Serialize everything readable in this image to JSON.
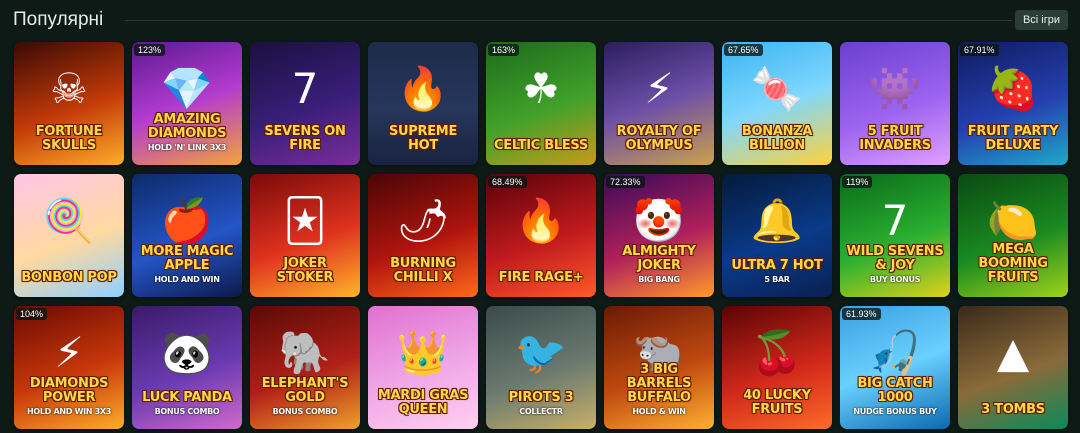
{
  "header": {
    "title": "Популярні",
    "all_button": "Всі ігри"
  },
  "games": [
    {
      "name": "Fortune Skulls",
      "sub": "",
      "badge": "",
      "icon": "skull-icon",
      "glyph": "☠",
      "bg": "linear-gradient(160deg,#3a0a05,#c33a08 55%,#ffae2a)"
    },
    {
      "name": "Amazing Diamonds",
      "sub": "HOLD 'N' LINK 3X3",
      "badge": "123%",
      "icon": "diamond-icon",
      "glyph": "💎",
      "bg": "linear-gradient(160deg,#5b1a8f,#b33bd0 50%,#f3a33a)"
    },
    {
      "name": "Sevens on Fire",
      "sub": "",
      "badge": "",
      "icon": "seven-icon",
      "glyph": "7",
      "bg": "linear-gradient(160deg,#1a1040,#3a1e7a 55%,#7a2e9a)"
    },
    {
      "name": "Supreme Hot",
      "sub": "",
      "badge": "",
      "icon": "flame-icon",
      "glyph": "🔥",
      "bg": "linear-gradient(180deg,#1e2a4a,#26365c 55%,#1a2340)"
    },
    {
      "name": "Celtic Bless",
      "sub": "",
      "badge": "163%",
      "icon": "leprechaun-icon",
      "glyph": "☘",
      "bg": "linear-gradient(160deg,#1d6a1a,#41a12b 55%,#c89a1a)"
    },
    {
      "name": "Royalty of Olympus",
      "sub": "",
      "badge": "",
      "icon": "zeus-icon",
      "glyph": "⚡",
      "bg": "linear-gradient(160deg,#2a1e5e,#6d4fa8 50%,#caa14a)"
    },
    {
      "name": "Bonanza Billion",
      "sub": "",
      "badge": "67.65%",
      "icon": "candy-icon",
      "glyph": "🍬",
      "bg": "linear-gradient(160deg,#3ab3f0,#7fd7ff 50%,#ffd23a)"
    },
    {
      "name": "5 Fruit Invaders",
      "sub": "",
      "badge": "",
      "icon": "alien-icon",
      "glyph": "👾",
      "bg": "linear-gradient(160deg,#6c3fd0,#9c64f0 55%,#e0a0ff)"
    },
    {
      "name": "Fruit Party Deluxe",
      "sub": "",
      "badge": "67.91%",
      "icon": "strawberry-icon",
      "glyph": "🍓",
      "bg": "linear-gradient(160deg,#101a5e,#2440b0 55%,#1fa8c8)"
    },
    {
      "name": "Bonbon Pop",
      "sub": "",
      "badge": "",
      "icon": "lollipop-icon",
      "glyph": "🍭",
      "bg": "linear-gradient(160deg,#ffc4e8,#ffd9a0 55%,#8fd0ff)"
    },
    {
      "name": "More Magic Apple",
      "sub": "HOLD AND WIN",
      "badge": "",
      "icon": "apple-icon",
      "glyph": "🍎",
      "bg": "linear-gradient(160deg,#0d2a6a,#2455c7 55%,#0d1a4a)"
    },
    {
      "name": "Joker Stoker",
      "sub": "",
      "badge": "",
      "icon": "joker-icon",
      "glyph": "🃏",
      "bg": "linear-gradient(160deg,#7a0a0a,#e0321e 55%,#ffb52a)"
    },
    {
      "name": "Burning Chilli X",
      "sub": "",
      "badge": "",
      "icon": "chilli-icon",
      "glyph": "🌶",
      "bg": "linear-gradient(160deg,#4a0606,#b0140e 55%,#ff6a1a)"
    },
    {
      "name": "Fire Rage+",
      "sub": "",
      "badge": "68.49%",
      "icon": "fire-icon",
      "glyph": "🔥",
      "bg": "linear-gradient(160deg,#5a0208,#c01a1e 55%,#ff5a2a)"
    },
    {
      "name": "Almighty Joker",
      "sub": "BIG BANG",
      "badge": "72.33%",
      "icon": "jester-icon",
      "glyph": "🤡",
      "bg": "linear-gradient(160deg,#3a0a5a,#b0205a 55%,#ff9a2a)"
    },
    {
      "name": "Ultra 7 Hot",
      "sub": "5 BAR",
      "badge": "",
      "icon": "bell-icon",
      "glyph": "🔔",
      "bg": "linear-gradient(160deg,#041a3a,#0a3a8a 55%,#0a2050)"
    },
    {
      "name": "Wild Sevens & Joy",
      "sub": "BUY BONUS",
      "badge": "119%",
      "icon": "seven-icon",
      "glyph": "7",
      "bg": "linear-gradient(160deg,#0a6a1a,#2ab030 55%,#e0d21a)"
    },
    {
      "name": "Mega Booming Fruits",
      "sub": "",
      "badge": "",
      "icon": "fruit-icon",
      "glyph": "🍋",
      "bg": "linear-gradient(160deg,#0a4a12,#1a8a20 55%,#a0d21a)"
    },
    {
      "name": "Diamonds Power",
      "sub": "HOLD AND WIN 3X3",
      "badge": "104%",
      "icon": "lightning-icon",
      "glyph": "⚡",
      "bg": "linear-gradient(160deg,#6a0a02,#c8380a 55%,#ffae2a)"
    },
    {
      "name": "Luck Panda",
      "sub": "BONUS COMBO",
      "badge": "",
      "icon": "panda-icon",
      "glyph": "🐼",
      "bg": "linear-gradient(160deg,#3a1a6a,#6a3ab0 55%,#d06acc)"
    },
    {
      "name": "Elephant's Gold",
      "sub": "BONUS COMBO",
      "badge": "",
      "icon": "elephant-icon",
      "glyph": "🐘",
      "bg": "linear-gradient(160deg,#5a0a06,#b02018 55%,#f0a02a)"
    },
    {
      "name": "Mardi Gras Queen",
      "sub": "",
      "badge": "",
      "icon": "crown-icon",
      "glyph": "👑",
      "bg": "linear-gradient(160deg,#e070d0,#f0a8e8 55%,#ffd0f0)"
    },
    {
      "name": "Pirots 3",
      "sub": "CollectR",
      "badge": "",
      "icon": "bird-icon",
      "glyph": "🐦",
      "bg": "linear-gradient(160deg,#3a4a4a,#6a7a70 55%,#c8b068)"
    },
    {
      "name": "3 Big Barrels Buffalo",
      "sub": "HOLD & WIN",
      "badge": "",
      "icon": "buffalo-icon",
      "glyph": "🐃",
      "bg": "linear-gradient(160deg,#6a1a04,#c04a10 55%,#ffb030)"
    },
    {
      "name": "40 Lucky Fruits",
      "sub": "",
      "badge": "",
      "icon": "cherry-icon",
      "glyph": "🍒",
      "bg": "linear-gradient(160deg,#5a0404,#d0281a 55%,#ff6a2a)"
    },
    {
      "name": "Big Catch 1000",
      "sub": "NUDGE BONUS BUY",
      "badge": "61.93%",
      "icon": "fisherman-icon",
      "glyph": "🎣",
      "bg": "linear-gradient(160deg,#3aa0e0,#6ad0ff 50%,#0a6ab0)"
    },
    {
      "name": "3 Tombs",
      "sub": "",
      "badge": "",
      "icon": "pyramid-icon",
      "glyph": "▲",
      "bg": "linear-gradient(160deg,#3a2a1a,#8a6a3a 55%,#0a8a5a)"
    }
  ]
}
